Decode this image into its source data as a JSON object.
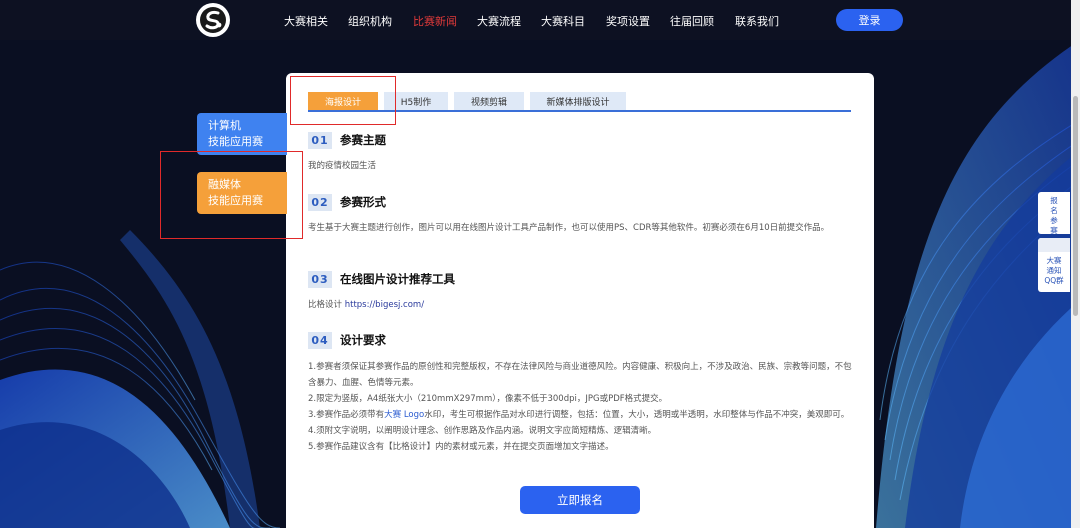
{
  "nav": {
    "items": [
      "大赛相关",
      "组织机构",
      "比赛新闻",
      "大赛流程",
      "大赛科目",
      "奖项设置",
      "往届回顾",
      "联系我们"
    ],
    "active_index": 2,
    "login_label": "登录"
  },
  "categories": [
    {
      "line1": "计算机",
      "line2": "技能应用赛"
    },
    {
      "line1": "融媒体",
      "line2": "技能应用赛"
    }
  ],
  "tabs": [
    "海报设计",
    "H5制作",
    "视频剪辑",
    "新媒体排版设计"
  ],
  "active_tab_index": 0,
  "sections": [
    {
      "num": "01",
      "title": "参赛主题",
      "body": "我的疫情校园生活"
    },
    {
      "num": "02",
      "title": "参赛形式",
      "body": "考生基于大赛主题进行创作，图片可以用在线图片设计工具产品制作，也可以使用PS、CDR等其他软件。初赛必须在6月10日前提交作品。"
    },
    {
      "num": "03",
      "title": "在线图片设计推荐工具",
      "tool_name": "比格设计",
      "tool_link": "https://bigesj.com/"
    },
    {
      "num": "04",
      "title": "设计要求",
      "items": [
        "1.参赛者须保证其参赛作品的原创性和完整版权，不存在法律风险与商业道德风险。内容健康、积极向上，不涉及政治、民族、宗教等问题，不包含暴力、血腥、色情等元素。",
        "2.限定为竖版，A4纸张大小（210mmX297mm），像素不低于300dpi，JPG或PDF格式提交。",
        "3.参赛作品必须带有",
        "大赛 Logo",
        "水印，考生可根据作品对水印进行调整，包括：位置，大小，透明或半透明，水印整体与作品不冲突，美观即可。",
        "4.须附文字说明，以阐明设计理念、创作思路及作品内涵。说明文字应简短精炼、逻辑清晰。",
        "5.参赛作品建议含有【比格设计】内的素材或元素，并在提交页面增加文字描述。"
      ]
    }
  ],
  "submit_label": "立即报名",
  "side": {
    "signup_label": "报名参赛",
    "qq_label": "大赛通知QQ群"
  },
  "colors": {
    "accent_blue": "#2b62f0",
    "accent_orange": "#f5a03a",
    "active_nav_red": "#e03a3a",
    "annotation_red": "#e02a2a"
  }
}
